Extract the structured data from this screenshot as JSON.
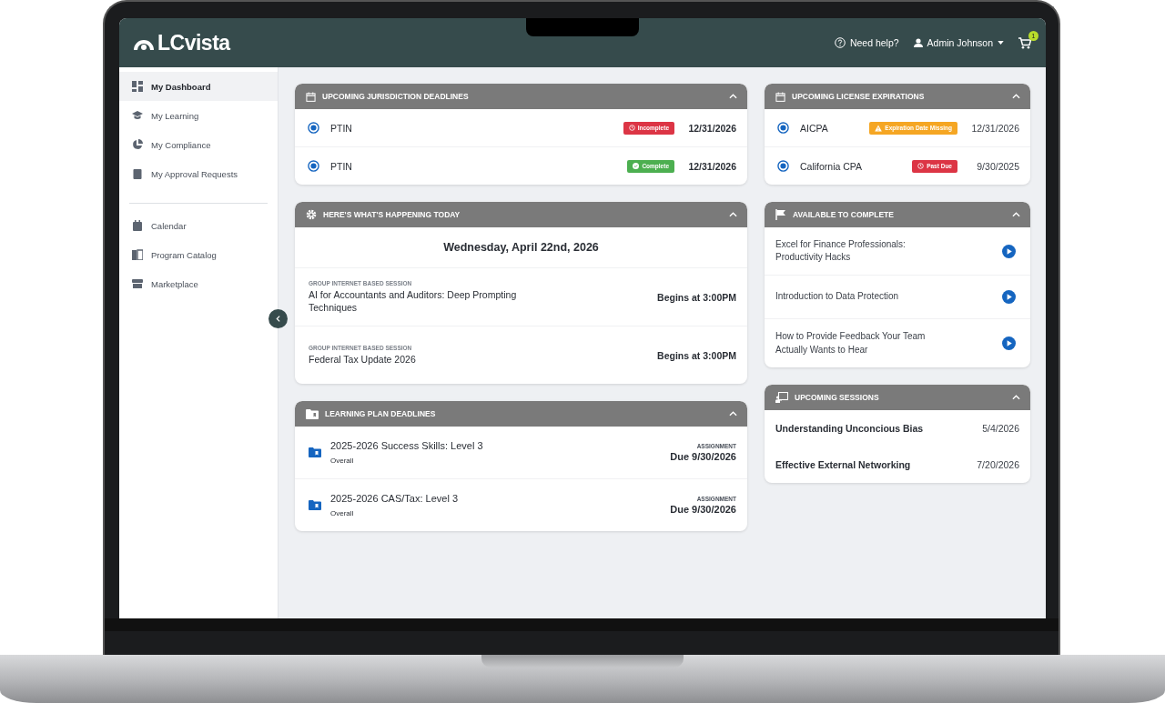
{
  "header": {
    "logo": "LCvista",
    "help": "Need help?",
    "user": "Admin Johnson",
    "cart_count": "1"
  },
  "sidebar": {
    "groups": [
      [
        {
          "label": "My Dashboard",
          "kind": "dashboard",
          "selected": true
        },
        {
          "label": "My Learning",
          "kind": "learning",
          "selected": false
        },
        {
          "label": "My Compliance",
          "kind": "compliance",
          "selected": false
        },
        {
          "label": "My Approval Requests",
          "kind": "approvals",
          "selected": false
        }
      ],
      [
        {
          "label": "Calendar",
          "kind": "calendar",
          "selected": false
        },
        {
          "label": "Program Catalog",
          "kind": "catalog",
          "selected": false
        },
        {
          "label": "Marketplace",
          "kind": "marketplace",
          "selected": false
        }
      ]
    ]
  },
  "jurisdiction_deadlines": {
    "title": "UPCOMING JURISDICTION DEADLINES",
    "rows": [
      {
        "name": "PTIN",
        "badge": {
          "text": "Incomplete",
          "kind": "incomplete"
        },
        "date": "12/31/2026"
      },
      {
        "name": "PTIN",
        "badge": {
          "text": "Complete",
          "kind": "complete"
        },
        "date": "12/31/2026"
      }
    ]
  },
  "happening_today": {
    "title": "HERE'S WHAT'S HAPPENING TODAY",
    "date": "Wednesday, April 22nd, 2026",
    "sessions": [
      {
        "type": "GROUP INTERNET BASED SESSION",
        "title": "AI for Accountants and Auditors: Deep Prompting Techniques",
        "time": "Begins at 3:00PM"
      },
      {
        "type": "GROUP INTERNET BASED SESSION",
        "title": "Federal Tax Update 2026",
        "time": "Begins at 3:00PM"
      }
    ]
  },
  "learning_plan_deadlines": {
    "title": "LEARNING PLAN DEADLINES",
    "rows": [
      {
        "name": "2025-2026 Success Skills: Level 3",
        "scope": "Overall",
        "type": "ASSIGNMENT",
        "due": "Due 9/30/2026"
      },
      {
        "name": "2025-2026 CAS/Tax: Level 3",
        "scope": "Overall",
        "type": "ASSIGNMENT",
        "due": "Due 9/30/2026"
      }
    ]
  },
  "license_expirations": {
    "title": "UPCOMING LICENSE EXPIRATIONS",
    "rows": [
      {
        "name": "AICPA",
        "badge": {
          "text": "Expiration Date Missing",
          "kind": "missing"
        },
        "date": "12/31/2026"
      },
      {
        "name": "California CPA",
        "badge": {
          "text": "Past Due",
          "kind": "pastdue"
        },
        "date": "9/30/2025"
      }
    ]
  },
  "available_to_complete": {
    "title": "AVAILABLE TO COMPLETE",
    "items": [
      {
        "title": "Excel for Finance Professionals: Productivity Hacks"
      },
      {
        "title": "Introduction to Data Protection"
      },
      {
        "title": "How to Provide Feedback Your Team Actually Wants to Hear"
      }
    ]
  },
  "upcoming_sessions": {
    "title": "UPCOMING SESSIONS",
    "rows": [
      {
        "title": "Understanding Unconcious Bias",
        "date": "5/4/2026"
      },
      {
        "title": "Effective External Networking",
        "date": "7/20/2026"
      }
    ]
  }
}
